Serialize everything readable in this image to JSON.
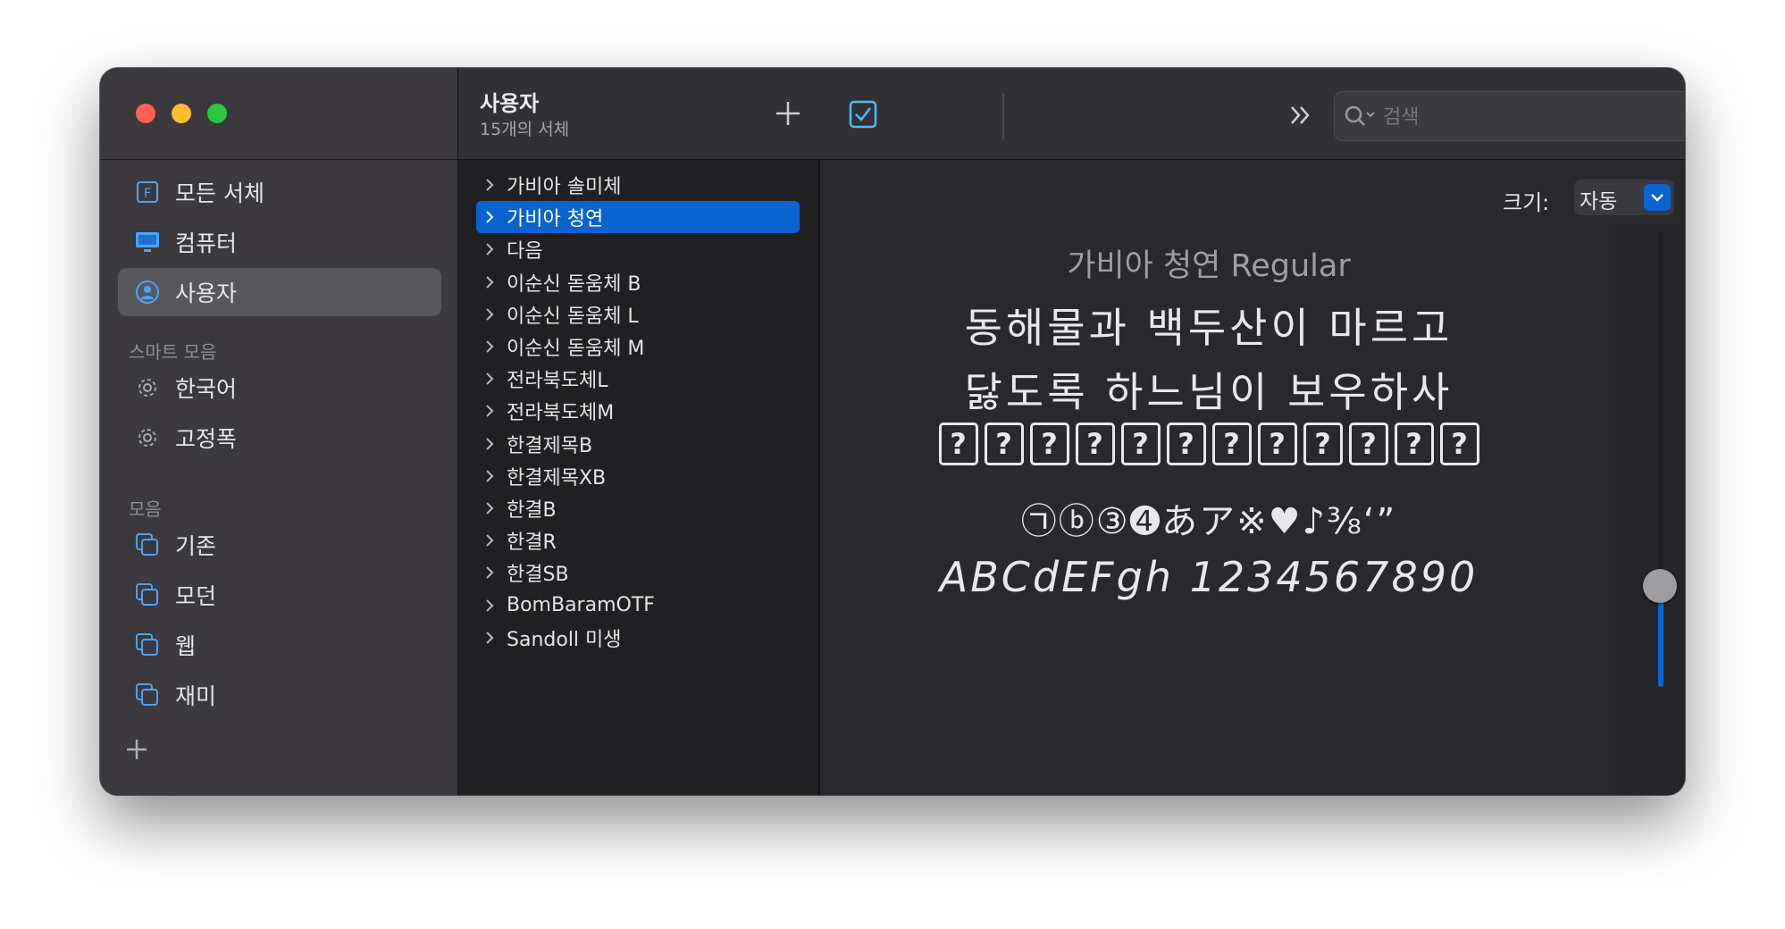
{
  "sidebar": {
    "items": [
      {
        "label": "모든 서체",
        "icon": "font-book-icon"
      },
      {
        "label": "컴퓨터",
        "icon": "computer-icon"
      },
      {
        "label": "사용자",
        "icon": "user-icon"
      }
    ],
    "smart_section": "스마트 모음",
    "smart_items": [
      {
        "label": "한국어",
        "icon": "gear-icon"
      },
      {
        "label": "고정폭",
        "icon": "gear-icon"
      }
    ],
    "collections_section": "모음",
    "collections": [
      {
        "label": "기존",
        "icon": "collection-icon"
      },
      {
        "label": "모던",
        "icon": "collection-icon"
      },
      {
        "label": "웹",
        "icon": "collection-icon"
      },
      {
        "label": "재미",
        "icon": "collection-icon"
      }
    ],
    "selected_index": 2
  },
  "header": {
    "title": "사용자",
    "subtitle": "15개의 서체",
    "search_placeholder": "검색"
  },
  "fonts": [
    "가비아 솔미체",
    "가비아 청연",
    "다음",
    "이순신 돋움체 B",
    "이순신 돋움체 L",
    "이순신 돋움체 M",
    "전라북도체L",
    "전라북도체M",
    "한결제목B",
    "한결제목XB",
    "한결B",
    "한결R",
    "한결SB",
    "BomBaramOTF",
    "Sandoll 미생"
  ],
  "selected_font_index": 1,
  "preview": {
    "size_label": "크기:",
    "size_value": "자동",
    "font_title": "가비아 청연 Regular",
    "line1": "동해물과 백두산이 마르고",
    "line2": "닳도록 하느님이 보우하사",
    "missing_glyph": "?",
    "missing_glyph_count": 12,
    "line4": "㉠ⓑ③➍あア※♥♪⅜‘”",
    "line5": "ABCdEFgh 1234567890",
    "slider_level": 0.25
  },
  "colors": {
    "accent": "#0a63cf",
    "close": "#fe5f57",
    "minimize": "#febc2e",
    "zoom": "#28c840"
  }
}
